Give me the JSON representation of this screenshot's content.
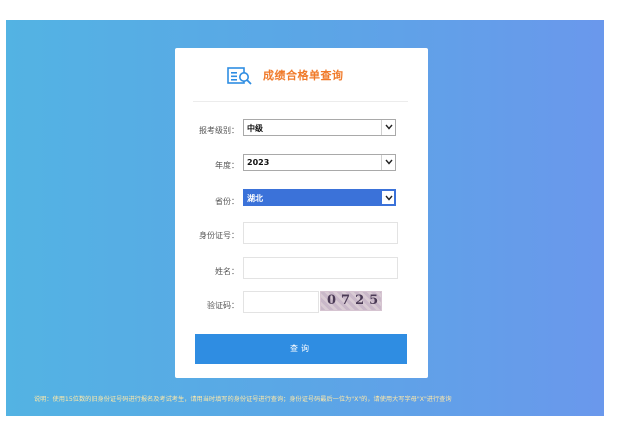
{
  "title": "成绩合格单查询",
  "icon": "document-search-icon",
  "form": {
    "level_label": "报考级别：",
    "level_value": "中级",
    "year_label": "年度：",
    "year_value": "2023",
    "province_label": "省份：",
    "province_value": "湖北",
    "id_label": "身份证号：",
    "id_value": "",
    "name_label": "姓名：",
    "name_value": "",
    "captcha_label": "验证码：",
    "captcha_value": "",
    "captcha_code": "0725"
  },
  "submit_label": "查询",
  "note": "说明：使用15位数的旧身份证号码进行报名及考试考生，请用当时填写的身份证号进行查询；身份证号码最后一位为\"X\"的，请使用大写字母\"X\"进行查询",
  "colors": {
    "title": "#f07a2a",
    "button": "#2f8de2",
    "background_left": "#53b3e3",
    "background_right": "#6a98ec",
    "note": "#ffe9a8"
  }
}
